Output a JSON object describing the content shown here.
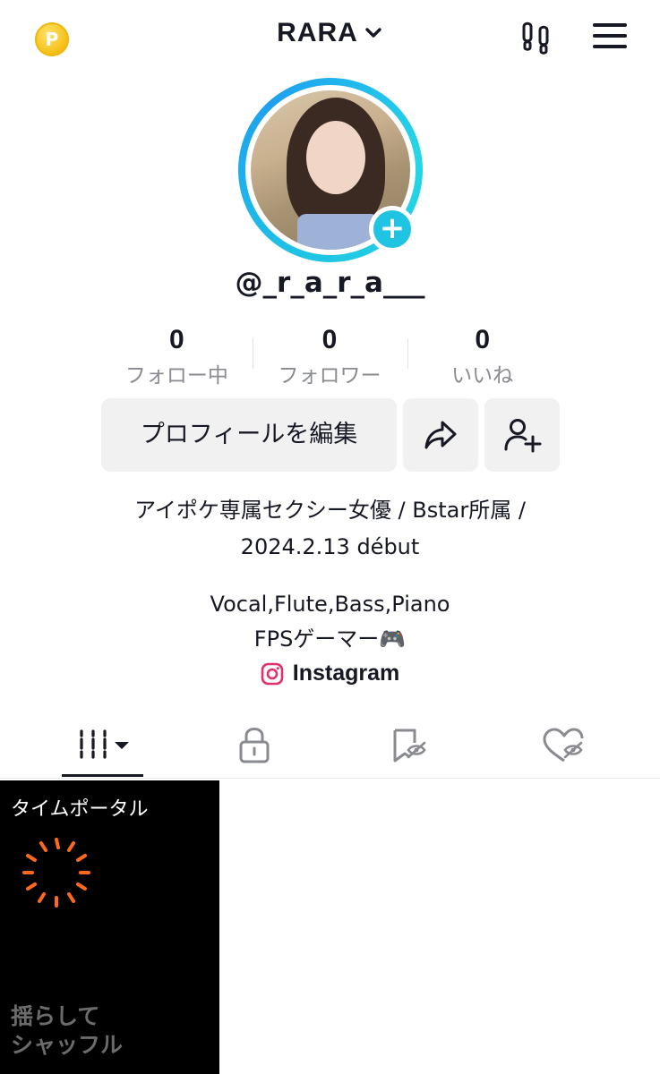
{
  "header": {
    "coin_icon_letter": "P",
    "title": "RARA",
    "title_chevron_icon": "chevron-down-icon",
    "footprint_icon": "footprint-icon",
    "menu_icon": "hamburger-menu-icon"
  },
  "profile": {
    "avatar_add_icon": "+",
    "username": "@_r_a_r_a___"
  },
  "stats": [
    {
      "value": "0",
      "label": "フォロー中"
    },
    {
      "value": "0",
      "label": "フォロワー"
    },
    {
      "value": "0",
      "label": "いいね"
    }
  ],
  "actions": {
    "edit_profile": "プロフィールを編集",
    "share_icon": "share-icon",
    "add_friend_icon": "add-friend-icon"
  },
  "bio": {
    "line1": "アイポケ専属セクシー女優 / Bstar所属 /",
    "line2": "2024.2.13 début",
    "line3": "Vocal,Flute,Bass,Piano",
    "line4": "FPSゲーマー🎮",
    "instagram_label": "Instagram"
  },
  "tabs": [
    {
      "icon": "videos-grid-icon",
      "active": true
    },
    {
      "icon": "lock-icon",
      "active": false
    },
    {
      "icon": "favorites-hidden-icon",
      "active": false
    },
    {
      "icon": "liked-hidden-icon",
      "active": false
    }
  ],
  "video_tile": {
    "title": "タイムポータル",
    "subtitle_line1": "揺らして",
    "subtitle_line2": "シャッフル"
  },
  "colors": {
    "accent_cyan": "#20c4e3",
    "text": "#161823",
    "muted": "#8a8b91",
    "button_bg": "#f1f1f2",
    "loader_orange": "#ff6a1a",
    "instagram_pink": "#e1306c"
  }
}
